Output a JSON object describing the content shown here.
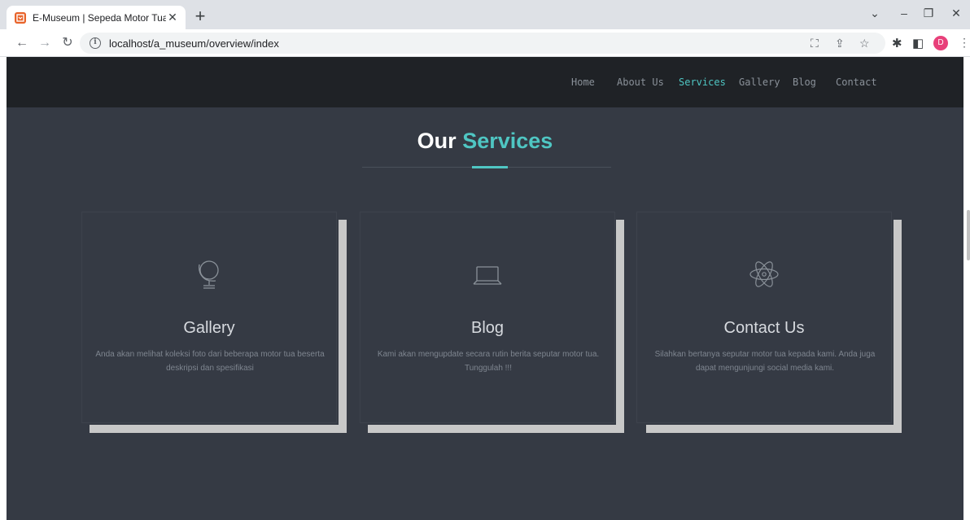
{
  "browser": {
    "tab_title": "E-Museum | Sepeda Motor Tua",
    "tab_close": "✕",
    "new_tab": "+",
    "url": "localhost/a_museum/overview/index",
    "profile_initial": "D",
    "controls": {
      "minimize": "–",
      "restore": "❐",
      "close": "✕",
      "tab_list": "⌄"
    }
  },
  "nav": {
    "items": [
      "Home",
      "About Us",
      "Services",
      "Gallery",
      "Blog",
      "Contact"
    ],
    "active": "Services"
  },
  "section": {
    "title_main": "Our",
    "title_accent": "Services"
  },
  "cards": [
    {
      "icon": "globe-icon",
      "title": "Gallery",
      "desc": "Anda akan melihat koleksi foto dari beberapa motor tua beserta deskripsi dan spesifikasi"
    },
    {
      "icon": "laptop-icon",
      "title": "Blog",
      "desc": "Kami akan mengupdate secara rutin berita seputar motor tua. Tunggulah !!!"
    },
    {
      "icon": "atom-icon",
      "title": "Contact Us",
      "desc": "Silahkan bertanya seputar motor tua kepada kami. Anda juga dapat mengunjungi social media kami."
    }
  ],
  "colors": {
    "accent": "#4fc6c3",
    "page_bg": "#353a44",
    "nav_bg": "#1f2226"
  }
}
